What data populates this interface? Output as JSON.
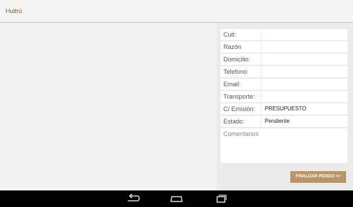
{
  "app": {
    "title": "Huitrú"
  },
  "form": {
    "fields": [
      {
        "label": "Cuit:",
        "value": ""
      },
      {
        "label": "Razón",
        "value": ""
      },
      {
        "label": "Domicilio:",
        "value": ""
      },
      {
        "label": "Telefono:",
        "value": ""
      },
      {
        "label": "Email:",
        "value": ""
      },
      {
        "label": "Transporte:",
        "value": ""
      },
      {
        "label": "C/ Emisión:",
        "value": "PRESUPUESTO"
      },
      {
        "label": "Estado:",
        "value": "Pendiente"
      }
    ],
    "comments_placeholder": "Comentarios",
    "finalize_label": "FINALIZAR PEDIDO >>"
  },
  "navbar": {
    "icons": [
      "back-icon",
      "home-icon",
      "recent-apps-icon"
    ]
  },
  "colors": {
    "accent": "#b8946a",
    "title": "#7a5a3a",
    "navbar": "#000000"
  }
}
